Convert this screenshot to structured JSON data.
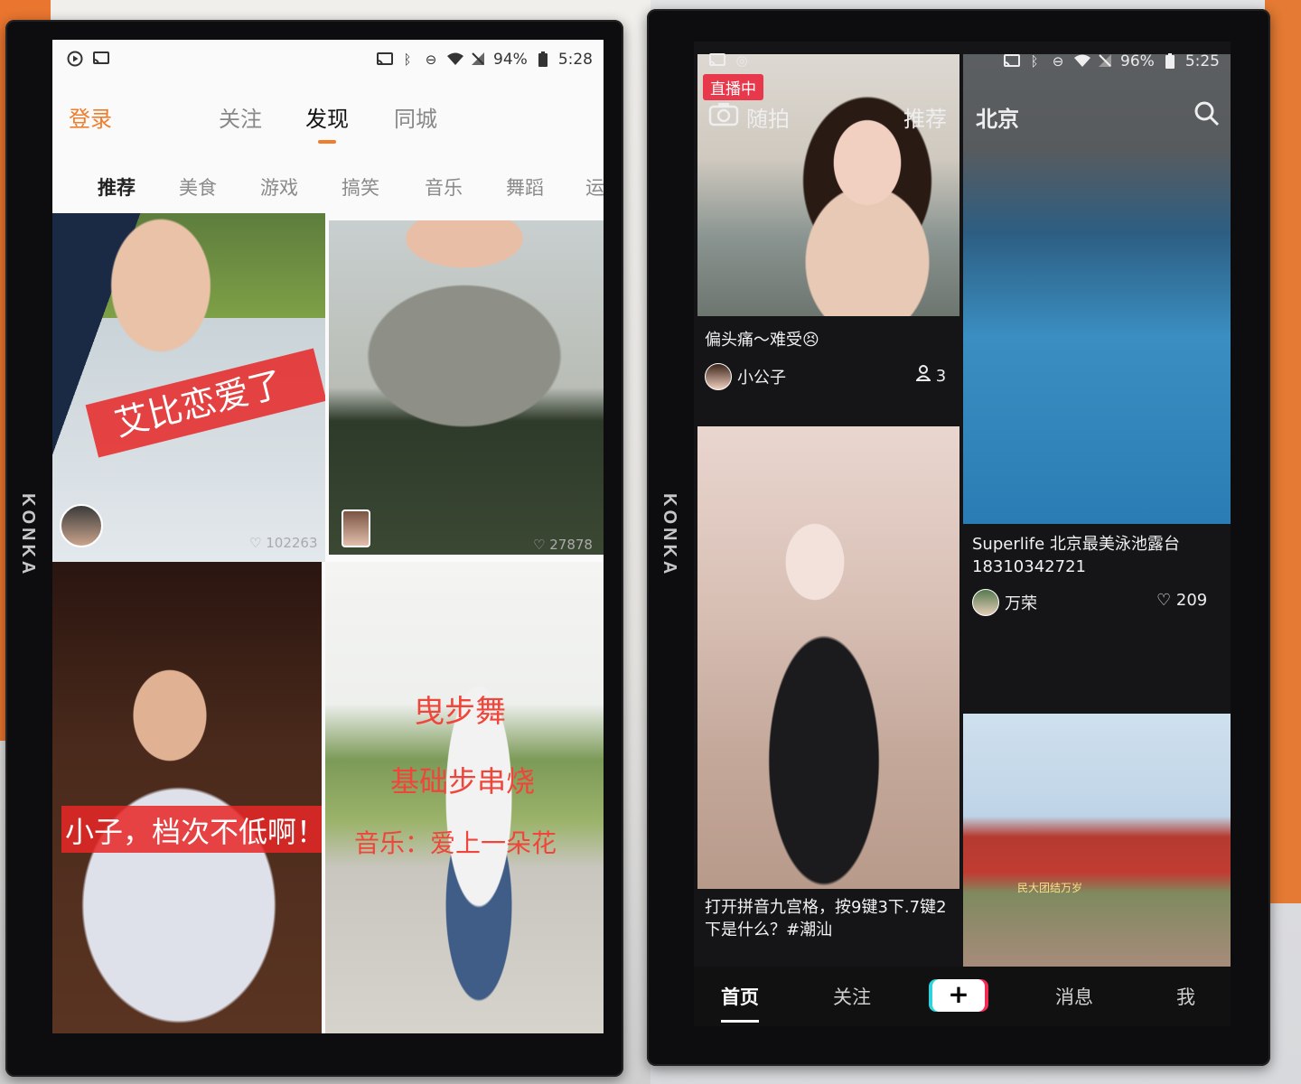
{
  "tv_brand": "KONKA",
  "left_phone": {
    "status": {
      "battery": "94%",
      "time": "5:28"
    },
    "header": {
      "login": "登录",
      "tabs": [
        "关注",
        "发现",
        "同城"
      ],
      "active_tab": "发现"
    },
    "categories": [
      "推荐",
      "美食",
      "游戏",
      "搞笑",
      "音乐",
      "舞蹈",
      "运"
    ],
    "cards": [
      {
        "overlay": "艾比恋爱了",
        "likes": "102263"
      },
      {
        "likes": "27878"
      },
      {
        "overlay": "小子，档次不低啊！"
      },
      {
        "overlay_lines": [
          "曳步舞",
          "基础步串烧",
          "音乐：爱上一朵花"
        ]
      }
    ]
  },
  "right_phone": {
    "status": {
      "battery": "96%",
      "time": "5:25"
    },
    "header": {
      "live_badge": "直播中",
      "camera_label": "随拍",
      "recommend": "推荐",
      "city": "北京"
    },
    "cards": [
      {
        "caption": "偏头痛～难受😣",
        "user": "小公子",
        "viewers": "3"
      },
      {
        "caption": "Superlife 北京最美泳池露台 18310342721",
        "user": "万荣",
        "likes": "209"
      },
      {
        "caption": "打开拼音九宫格，按9键3下.7键2下是什么？#潮汕"
      },
      {
        "banner_text": "民大团结万岁"
      }
    ],
    "bottom_nav": [
      "首页",
      "关注",
      "+",
      "消息",
      "我"
    ],
    "active_nav": "首页"
  }
}
